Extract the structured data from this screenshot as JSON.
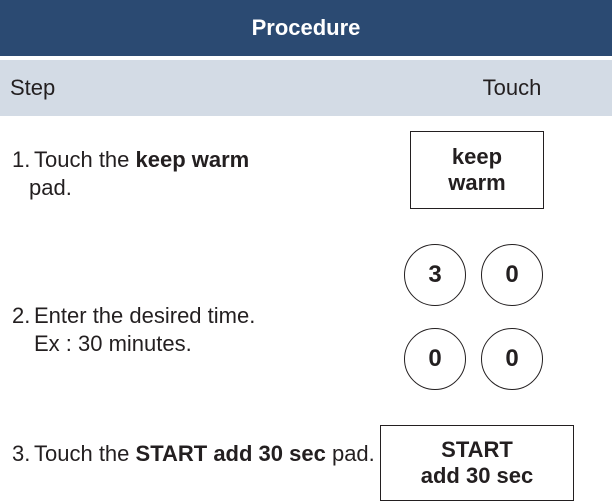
{
  "header": {
    "title": "Procedure"
  },
  "columns": {
    "step": "Step",
    "touch": "Touch"
  },
  "steps": [
    {
      "number": "1.",
      "before": "Touch the ",
      "bold": "keep warm",
      "after": " pad."
    },
    {
      "number": "2.",
      "line1": "Enter the desired time.",
      "line2": "Ex : 30 minutes."
    },
    {
      "number": "3.",
      "before": "Touch the ",
      "bold": "START add 30 sec",
      "after": " pad."
    }
  ],
  "pads": {
    "keep_warm": {
      "line1": "keep",
      "line2": "warm"
    },
    "digits": [
      "3",
      "0",
      "0",
      "0"
    ],
    "start": {
      "line1": "START",
      "line2": "add 30 sec"
    }
  },
  "colors": {
    "header_bg": "#2b4a72",
    "subheader_bg": "#d3dbe5",
    "text": "#231f20"
  }
}
